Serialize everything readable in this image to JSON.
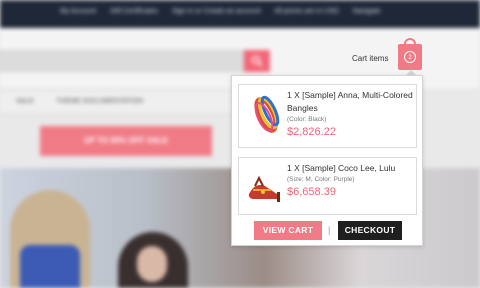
{
  "topbar": {
    "links": [
      "My Account",
      "Gift Certificates",
      "Sign in or Create an account",
      "All prices are in USD",
      "Navigate"
    ]
  },
  "nav": {
    "items": [
      "SALE",
      "THEME DOCUMENTATION"
    ]
  },
  "promo": {
    "label": "UP TO 50% OFF SALE"
  },
  "cart": {
    "label": "Cart items",
    "count": "2",
    "items": [
      {
        "quantity": "1 X",
        "name": "[Sample] Anna, Multi-Colored Bangles",
        "options": "(Color: Black)",
        "price": "$2,826.22"
      },
      {
        "quantity": "1 X",
        "name": "[Sample] Coco Lee, Lulu",
        "options": "(Size: M, Color: Purple)",
        "price": "$6,658.39"
      }
    ],
    "view_cart_label": "VIEW CART",
    "separator": "|",
    "checkout_label": "CHECKOUT"
  },
  "colors": {
    "accent": "#f07b87",
    "price": "#e9677a",
    "dark": "#1f1f1f",
    "topbar": "#1f2838"
  },
  "icons": {
    "search": "search-icon",
    "cart": "shopping-bag-icon"
  }
}
